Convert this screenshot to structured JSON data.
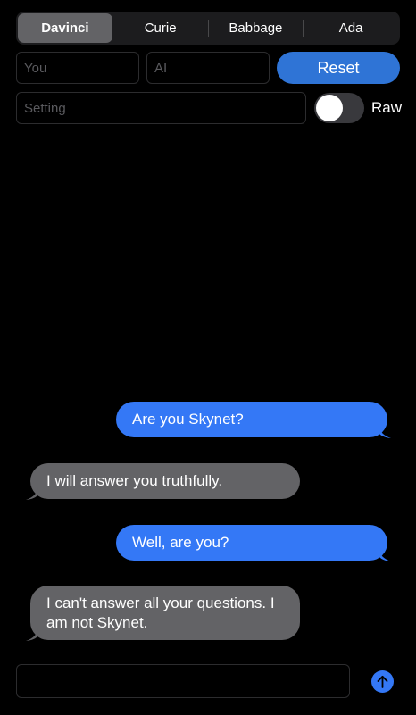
{
  "segments": [
    {
      "label": "Davinci",
      "selected": true
    },
    {
      "label": "Curie",
      "selected": false
    },
    {
      "label": "Babbage",
      "selected": false
    },
    {
      "label": "Ada",
      "selected": false
    }
  ],
  "fields": {
    "you_placeholder": "You",
    "ai_placeholder": "AI",
    "setting_placeholder": "Setting",
    "message_placeholder": ""
  },
  "reset_label": "Reset",
  "raw_label": "Raw",
  "raw_enabled": false,
  "messages": [
    {
      "sender": "me",
      "text": "Are you Skynet?"
    },
    {
      "sender": "ai",
      "text": "I will answer you truthfully."
    },
    {
      "sender": "me",
      "text": "Well, are you?"
    },
    {
      "sender": "ai",
      "text": "I can't answer all your questions. I am not Skynet."
    }
  ],
  "colors": {
    "accent": "#3478f6",
    "ai_bubble": "#636366",
    "background": "#000000"
  },
  "icons": {
    "send": "arrow-up-icon"
  }
}
